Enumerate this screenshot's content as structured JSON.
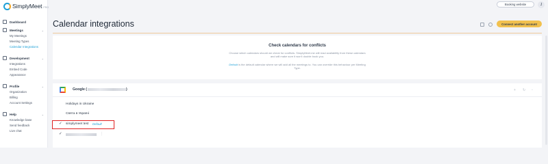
{
  "app": {
    "logo_text": "SimplyMeet",
    "logo_sub": "PRO"
  },
  "sidebar": {
    "sections": [
      {
        "label": "Dashboard",
        "icon": "dashboard-icon"
      },
      {
        "label": "Meetings",
        "icon": "calendar-icon",
        "chevron": "⌄",
        "items": [
          {
            "label": "My Meetings"
          },
          {
            "label": "Meeting Types"
          },
          {
            "label": "Calendar Integrations",
            "active": true
          }
        ]
      },
      {
        "label": "Development",
        "icon": "code-icon",
        "chevron": "⌄",
        "items": [
          {
            "label": "Integrations"
          },
          {
            "label": "Embed Code"
          },
          {
            "label": "Appearance"
          }
        ]
      },
      {
        "label": "Profile",
        "icon": "user-icon",
        "chevron": "⌄",
        "items": [
          {
            "label": "Organization"
          },
          {
            "label": "Billing"
          },
          {
            "label": "Account Settings"
          }
        ]
      },
      {
        "label": "Help",
        "icon": "help-icon",
        "chevron": "⌄",
        "items": [
          {
            "label": "Knowledge base"
          },
          {
            "label": "Send feedback"
          },
          {
            "label": "Live chat"
          }
        ]
      }
    ]
  },
  "topbar": {
    "booking_label": "Booking website",
    "avatar_initial": "J"
  },
  "header": {
    "title": "Calendar integrations",
    "connect_label": "Connect another account"
  },
  "conflicts": {
    "title": "Check calendars for conflicts",
    "description": "Choose which calendars should we check for conflicts. SimplyMeet.me will read availability from these calendars and will make sure it won't double book you.",
    "note_default": "Default",
    "note_rest": " is the default calendar where we will add all the meetings to. You can override this behaviour per Meeting Type."
  },
  "account": {
    "name_prefix": "Google (",
    "name_suffix": ")",
    "calendars": [
      {
        "name": "Holidays in Ukraine",
        "checked": false
      },
      {
        "name": "Свята в Україні",
        "checked": false
      },
      {
        "name": "simplymeet test",
        "checked": true,
        "badge": "Default"
      },
      {
        "name": "",
        "checked": true,
        "redacted": true,
        "menu": "⋮"
      }
    ]
  },
  "colors": {
    "accent": "#1c9fd6",
    "cta": "#f2c14e",
    "highlight": "#e02020"
  }
}
